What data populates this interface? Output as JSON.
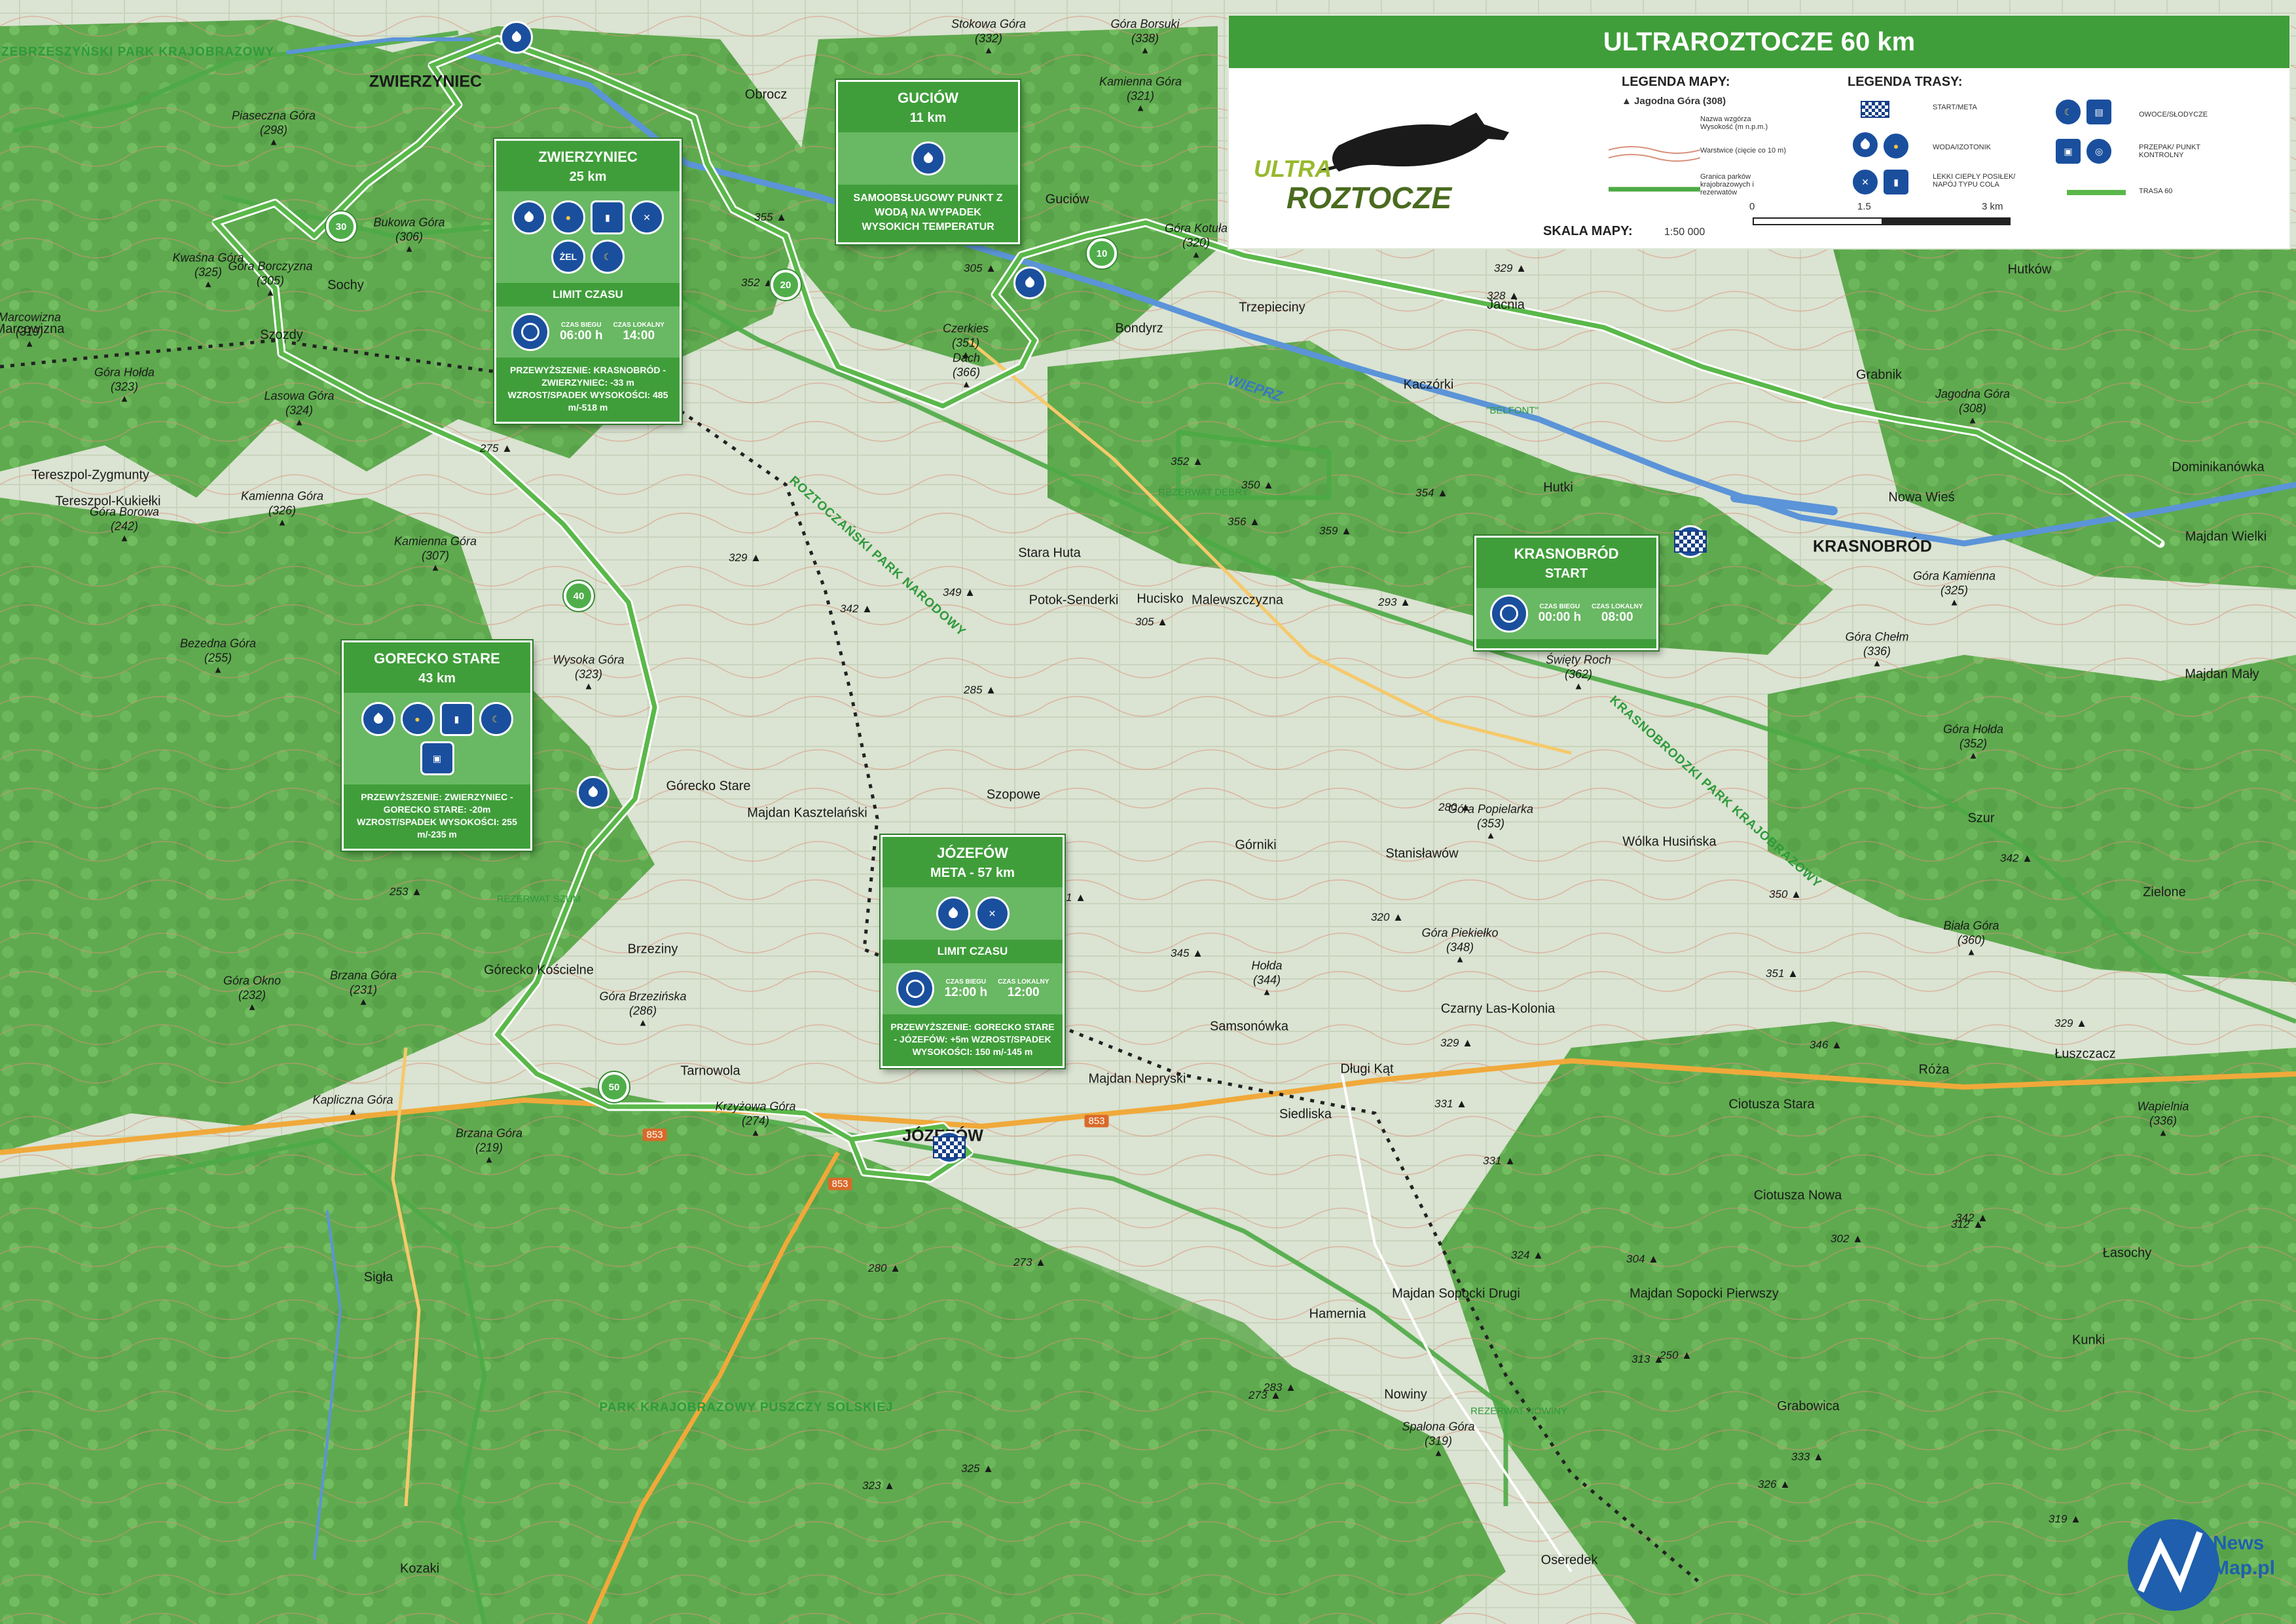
{
  "title": "ULTRAROZTOCZE 60 km",
  "legend": {
    "map_heading": "LEGENDA MAPY:",
    "route_heading": "LEGENDA TRASY:",
    "hill_sample_name": "Jagodna Góra",
    "hill_sample_elev": "(308)",
    "hill_desc": "Nazwa wzgórza Wysokość (m n.p.m.)",
    "contour_desc": "Warstwice (cięcie co 10 m)",
    "park_desc": "Granica parków krajobrazowych i rezerwatów",
    "start_meta": "START/META",
    "water": "WODA/IZOTONIK",
    "meal": "LEKKI CIEPŁY POSIŁEK/ NAPÓJ TYPU COLA",
    "fruit": "OWOCE/SŁODYCZE",
    "bag": "PRZEPAK/ PUNKT KONTROLNY",
    "trasa": "TRASA 60",
    "scale_label": "SKALA MAPY:",
    "scale_value": "1:50 000",
    "scale_ticks": [
      "0",
      "1.5",
      "3 km"
    ],
    "logo_top": "ULTRA",
    "logo_bottom": "ROZTOCZE"
  },
  "colors": {
    "green": "#3f9e3a",
    "light_green": "#69b863",
    "blue_icon": "#1a4f9e",
    "route": "#5ab84a",
    "river": "#5b94d8"
  },
  "panels": [
    {
      "id": "zwierzyniec",
      "title": "ZWIERZYNIEC",
      "sub": "25 km",
      "icons": [
        "water-icon",
        "isotonic-icon",
        "cola-icon",
        "meal-icon",
        "gel-icon",
        "fruit-icon"
      ],
      "gel": "ŻEL",
      "limit": "LIMIT CZASU",
      "h1": "CZAS BIEGU",
      "h2": "CZAS LOKALNY",
      "t1": "06:00 h",
      "t2": "14:00",
      "note": "PRZEWYŻSZENIE: KRASNOBRÓD - ZWIERZYNIEC: -33 m WZROST/SPADEK WYSOKOŚCI: 485 m/-518 m"
    },
    {
      "id": "guciow",
      "title": "GUCIÓW",
      "sub": "11 km",
      "desc": "SAMOOBSŁUGOWY PUNKT Z WODĄ NA WYPADEK WYSOKICH TEMPERATUR"
    },
    {
      "id": "krasnobrod",
      "title": "KRASNOBRÓD",
      "sub": "START",
      "h1": "CZAS BIEGU",
      "h2": "CZAS LOKALNY",
      "t1": "00:00 h",
      "t2": "08:00"
    },
    {
      "id": "gorecko",
      "title": "GORECKO STARE",
      "sub": "43 km",
      "note": "PRZEWYŻSZENIE: ZWIERZYNIEC - GORECKO STARE: -20m WZROST/SPADEK WYSOKOŚCI: 255 m/-235 m"
    },
    {
      "id": "jozefow",
      "title": "JÓZEFÓW",
      "sub": "META - 57 km",
      "limit": "LIMIT CZASU",
      "h1": "CZAS BIEGU",
      "h2": "CZAS LOKALNY",
      "t1": "12:00 h",
      "t2": "12:00",
      "note": "PRZEWYŻSZENIE: GORECKO STARE - JÓZEFÓW: +5m WZROST/SPADEK WYSOKOŚCI: 150 m/-145 m"
    }
  ],
  "towns": [
    {
      "n": "ZWIERZYNIEC",
      "big": true
    },
    {
      "n": "KRASNOBRÓD",
      "big": true
    },
    {
      "n": "JÓZEFÓW",
      "big": true
    },
    {
      "n": "Obrocz"
    },
    {
      "n": "Guciów"
    },
    {
      "n": "Sochy"
    },
    {
      "n": "Szozdy"
    },
    {
      "n": "Bondyrz"
    },
    {
      "n": "Trzepieciny"
    },
    {
      "n": "Jacnia"
    },
    {
      "n": "Kaczórki"
    },
    {
      "n": "Hutków"
    },
    {
      "n": "Grabnik"
    },
    {
      "n": "Hutki"
    },
    {
      "n": "Nowa Wieś"
    },
    {
      "n": "Dominikanówka"
    },
    {
      "n": "Majdan Wielki"
    },
    {
      "n": "Majdan Mały"
    },
    {
      "n": "Stara Huta"
    },
    {
      "n": "Potok-Senderki"
    },
    {
      "n": "Hucisko"
    },
    {
      "n": "Malewszczyzna"
    },
    {
      "n": "Tereszpol-Zygmunty"
    },
    {
      "n": "Tereszpol-Kukiełki"
    },
    {
      "n": "Górecko Stare"
    },
    {
      "n": "Majdan Kasztelański"
    },
    {
      "n": "Szopowe"
    },
    {
      "n": "Górniki"
    },
    {
      "n": "Stanisławów"
    },
    {
      "n": "Wólka Husińska"
    },
    {
      "n": "Szur"
    },
    {
      "n": "Zielone"
    },
    {
      "n": "Brzeziny"
    },
    {
      "n": "Górecko Kościelne"
    },
    {
      "n": "Tarnowola"
    },
    {
      "n": "Samsonówka"
    },
    {
      "n": "Czarny Las-Kolonia"
    },
    {
      "n": "Majdan Nepryski"
    },
    {
      "n": "Długi Kąt"
    },
    {
      "n": "Siedliska"
    },
    {
      "n": "Ciotusza Stara"
    },
    {
      "n": "Róża"
    },
    {
      "n": "Łuszczacz"
    },
    {
      "n": "Ciotusza Nowa"
    },
    {
      "n": "Łasochy"
    },
    {
      "n": "Sigła"
    },
    {
      "n": "Majdan Sopocki Drugi"
    },
    {
      "n": "Majdan Sopocki Pierwszy"
    },
    {
      "n": "Hamernia"
    },
    {
      "n": "Kunki"
    },
    {
      "n": "Nowiny"
    },
    {
      "n": "Grabowica"
    },
    {
      "n": "Kozaki"
    },
    {
      "n": "Oseredek"
    },
    {
      "n": "Marcowizna"
    }
  ],
  "hills": [
    {
      "n": "Stokowa Góra",
      "e": "(332)"
    },
    {
      "n": "Góra Borsuki",
      "e": "(338)"
    },
    {
      "n": "Kamienna Góra",
      "e": "(321)"
    },
    {
      "n": "Piaseczna Góra",
      "e": "(298)"
    },
    {
      "n": "Bukowa Góra",
      "e": "(306)"
    },
    {
      "n": "Kwaśna Góra",
      "e": "(325)"
    },
    {
      "n": "Góra Borczyzna",
      "e": "(305)"
    },
    {
      "n": "Marcowizna",
      "e": "(319)"
    },
    {
      "n": "Góra Hołda",
      "e": "(323)"
    },
    {
      "n": "Lasowa Góra",
      "e": "(324)"
    },
    {
      "n": "Kamienna Góra",
      "e": "(326)"
    },
    {
      "n": "Góra Borowa",
      "e": "(242)"
    },
    {
      "n": "Kamienna Góra",
      "e": "(307)"
    },
    {
      "n": "Bezedna Góra",
      "e": "(255)"
    },
    {
      "n": "Wysoka Góra",
      "e": "(323)"
    },
    {
      "n": "Czerkies",
      "e": "(351)"
    },
    {
      "n": "Dach",
      "e": "(366)"
    },
    {
      "n": "Góra Kotuła",
      "e": "(320)"
    },
    {
      "n": "Jagodna Góra",
      "e": "(308)"
    },
    {
      "n": "Góra Kamienna",
      "e": "(325)"
    },
    {
      "n": "Góra Chełm",
      "e": "(336)"
    },
    {
      "n": "Święty Roch",
      "e": "(362)"
    },
    {
      "n": "Góra Hołda",
      "e": "(352)"
    },
    {
      "n": "Góra Popielarka",
      "e": "(353)"
    },
    {
      "n": "Góra Piekiełko",
      "e": "(348)"
    },
    {
      "n": "Hołda",
      "e": "(344)"
    },
    {
      "n": "Biała Góra",
      "e": "(360)"
    },
    {
      "n": "Góra Brzezińska",
      "e": "(286)"
    },
    {
      "n": "Góra Okno",
      "e": "(232)"
    },
    {
      "n": "Brzana Góra",
      "e": "(231)"
    },
    {
      "n": "Kapliczna Góra",
      "e": ""
    },
    {
      "n": "Brzana Góra",
      "e": "(219)"
    },
    {
      "n": "Krzyżowa Góra",
      "e": "(274)"
    },
    {
      "n": "Wapielnia",
      "e": "(336)"
    },
    {
      "n": "Spalona Góra",
      "e": "(319)"
    }
  ],
  "elevations": [
    "355",
    "352",
    "305",
    "329",
    "328",
    "352",
    "350",
    "356",
    "359",
    "354",
    "293",
    "349",
    "342",
    "305",
    "329",
    "275",
    "285",
    "280",
    "350",
    "351",
    "329",
    "346",
    "331",
    "342",
    "320",
    "345",
    "341",
    "329",
    "331",
    "324",
    "304",
    "302",
    "312",
    "342",
    "348",
    "253",
    "273",
    "280",
    "283",
    "250",
    "273",
    "313",
    "333",
    "326",
    "325",
    "323",
    "319"
  ],
  "parks": [
    "SZCZEBRZESZYŃSKI PARK KRAJOBRAZOWY",
    "ROZTOCZAŃSKI PARK NARODOWY",
    "KRASNOBRODZKI PARK KRAJOBRAZOWY",
    "PARK KRAJOBRAZOWY PUSZCZY SOLSKIEJ"
  ],
  "reserves": [
    "REZERWAT DEBRY",
    "REZERWAT SZUM",
    "REZERWAT NOWINY",
    "\"BELFONT\""
  ],
  "river": "WIEPRZ",
  "roads": [
    "853",
    "853",
    "853"
  ],
  "km_markers": [
    "30",
    "20",
    "10",
    "40",
    "50"
  ],
  "watermark": {
    "line1": "News",
    "line2": "Map.pl"
  }
}
